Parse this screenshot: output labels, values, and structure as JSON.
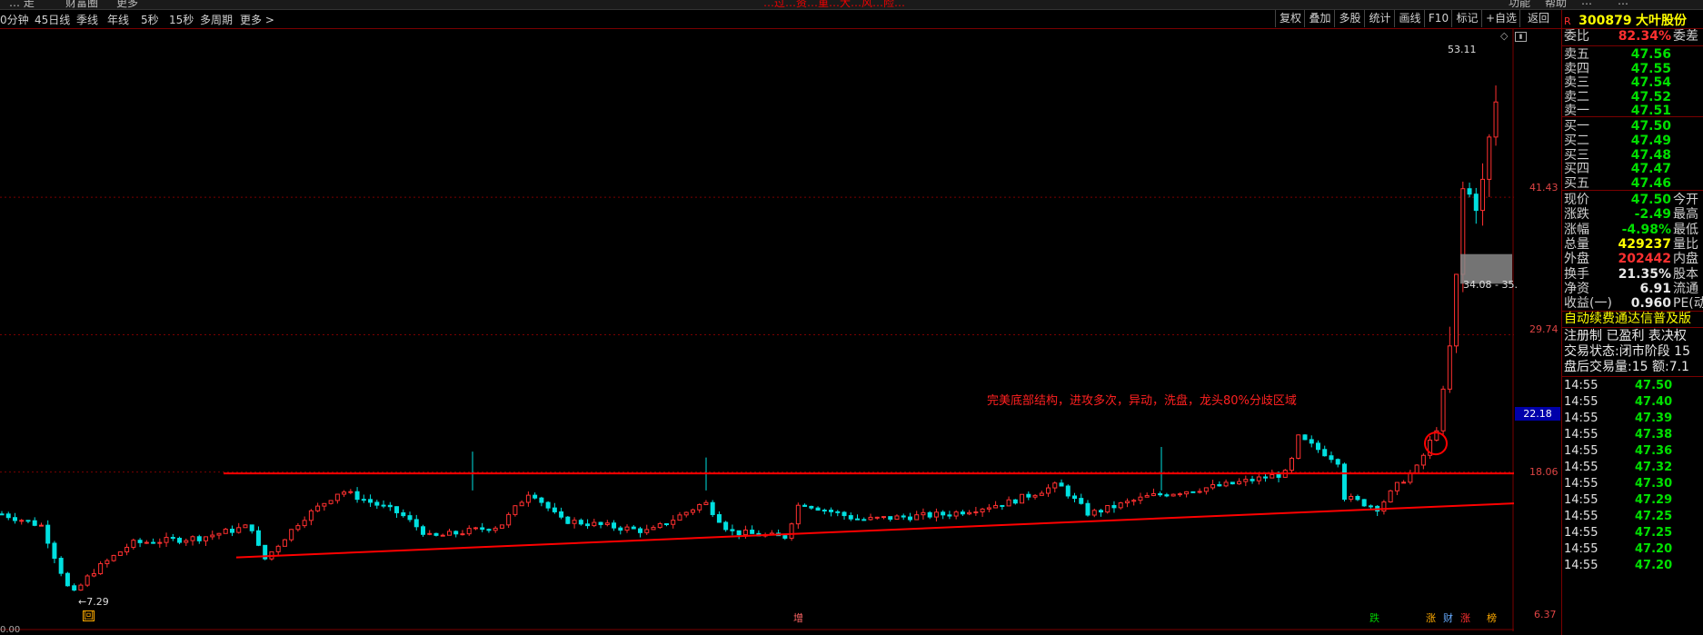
{
  "topbar": {
    "left_items": [
      "… 走",
      "财富圈",
      "更多"
    ],
    "alert": "…过…资…重…大…风…险…",
    "right_items": [
      "功能",
      "帮助",
      "…",
      "…"
    ]
  },
  "periods": [
    "0分钟",
    "45日线",
    "季线",
    "年线",
    "5秒",
    "15秒",
    "多周期",
    "更多 >"
  ],
  "toolbar": [
    "复权",
    "叠加",
    "多股",
    "统计",
    "画线",
    "F10",
    "标记",
    "+自选",
    "返回"
  ],
  "axis": {
    "ticks": [
      "41.43",
      "29.74",
      "18.06",
      "6.37"
    ],
    "current": "22.18"
  },
  "chart_labels": {
    "high": "53.11",
    "low": "7.29",
    "annotation": "完美底部结构，进攻多次，异动，洗盘，龙头80%分歧区域",
    "zone": "34.08 - 35.",
    "bottom_axis": "0.00"
  },
  "markers": [
    {
      "label": "回",
      "color": "#ffaa00"
    },
    {
      "label": "增",
      "color": "#ff6666"
    },
    {
      "label": "跌",
      "color": "#00cc00"
    },
    {
      "label": "涨",
      "color": "#ffaa00"
    },
    {
      "label": "财",
      "color": "#66aaff"
    },
    {
      "label": "涨",
      "color": "#ff3030"
    },
    {
      "label": "榜",
      "color": "#ffaa00"
    }
  ],
  "stock": {
    "tag": "R",
    "code": "300879",
    "name": "大叶股份"
  },
  "weibi": {
    "label": "委比",
    "value": "82.34%",
    "right": "委差"
  },
  "sells": [
    {
      "label": "卖五",
      "price": "47.56"
    },
    {
      "label": "卖四",
      "price": "47.55"
    },
    {
      "label": "卖三",
      "price": "47.54"
    },
    {
      "label": "卖二",
      "price": "47.52"
    },
    {
      "label": "卖一",
      "price": "47.51"
    }
  ],
  "buys": [
    {
      "label": "买一",
      "price": "47.50"
    },
    {
      "label": "买二",
      "price": "47.49"
    },
    {
      "label": "买三",
      "price": "47.48"
    },
    {
      "label": "买四",
      "price": "47.47"
    },
    {
      "label": "买五",
      "price": "47.46"
    }
  ],
  "quote": [
    {
      "k": "现价",
      "v": "47.50",
      "c": "green",
      "k2": "今开"
    },
    {
      "k": "涨跌",
      "v": "-2.49",
      "c": "green",
      "k2": "最高"
    },
    {
      "k": "涨幅",
      "v": "-4.98%",
      "c": "green",
      "k2": "最低"
    },
    {
      "k": "总量",
      "v": "429237",
      "c": "yellow",
      "k2": "量比"
    },
    {
      "k": "外盘",
      "v": "202442",
      "c": "red",
      "k2": "内盘"
    },
    {
      "k": "换手",
      "v": "21.35%",
      "c": "white",
      "k2": "股本"
    },
    {
      "k": "净资",
      "v": "6.91",
      "c": "white",
      "k2": "流通"
    },
    {
      "k": "收益(一)",
      "v": "0.960",
      "c": "white",
      "k2": "PE(动"
    }
  ],
  "info": [
    "自动续费通达信普及版",
    "注册制 已盈利 表决权",
    "交易状态:闭市阶段 15",
    "盘后交易量:15 额:7.1"
  ],
  "ticks": [
    {
      "t": "14:55",
      "p": "47.50"
    },
    {
      "t": "14:55",
      "p": "47.40"
    },
    {
      "t": "14:55",
      "p": "47.39"
    },
    {
      "t": "14:55",
      "p": "47.38"
    },
    {
      "t": "14:55",
      "p": "47.36"
    },
    {
      "t": "14:55",
      "p": "47.32"
    },
    {
      "t": "14:55",
      "p": "47.30"
    },
    {
      "t": "14:55",
      "p": "47.29"
    },
    {
      "t": "14:55",
      "p": "47.25"
    },
    {
      "t": "14:55",
      "p": "47.25"
    },
    {
      "t": "14:55",
      "p": "47.20"
    },
    {
      "t": "14:55",
      "p": "47.20"
    }
  ],
  "colors": {
    "up": "#ff3030",
    "down": "#00e0e0",
    "grid": "#7a0000",
    "text": "#d0d0d0"
  }
}
